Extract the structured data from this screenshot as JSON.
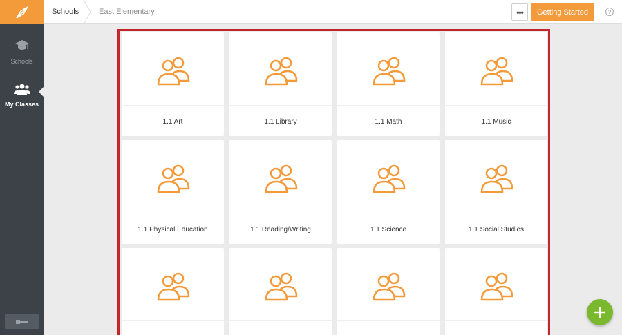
{
  "sidebar": {
    "logo_icon": "compass-icon",
    "items": [
      {
        "label": "Schools",
        "icon": "graduation-cap-icon"
      },
      {
        "label": "My Classes",
        "icon": "users-icon"
      }
    ],
    "logout_icon": "key-icon"
  },
  "header": {
    "breadcrumb_schools": "Schools",
    "breadcrumb_school": "East Elementary",
    "more_label": "•••",
    "getting_started": "Getting Started",
    "help_label": "?"
  },
  "classes": [
    {
      "name": "1.1 Art"
    },
    {
      "name": "1.1 Library"
    },
    {
      "name": "1.1 Math"
    },
    {
      "name": "1.1 Music"
    },
    {
      "name": "1.1 Physical Education"
    },
    {
      "name": "1.1 Reading/Writing"
    },
    {
      "name": "1.1 Science"
    },
    {
      "name": "1.1 Social Studies"
    },
    {
      "name": ""
    },
    {
      "name": ""
    },
    {
      "name": ""
    },
    {
      "name": ""
    }
  ],
  "colors": {
    "accent": "#f39a3b",
    "sidebar": "#3d4248",
    "highlight_border": "#c4262e",
    "fab": "#7ab82e"
  },
  "fab_icon": "plus-icon"
}
